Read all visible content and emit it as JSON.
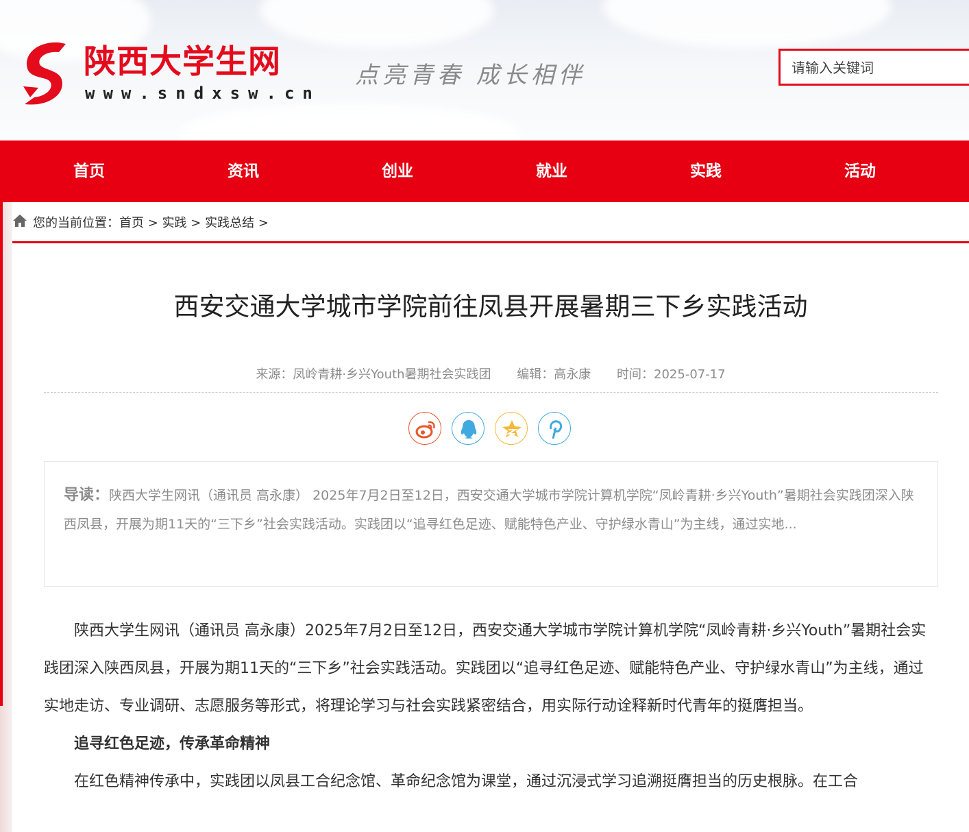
{
  "header": {
    "site_name": "陕西大学生网",
    "site_url": "www.sndxsw.cn",
    "slogan": "点亮青春 成长相伴",
    "search_placeholder": "请输入关键词"
  },
  "nav": {
    "items": [
      "首页",
      "资讯",
      "创业",
      "就业",
      "实践",
      "活动"
    ]
  },
  "breadcrumb": {
    "prefix": "您的当前位置：",
    "items": [
      "首页",
      "实践",
      "实践总结"
    ],
    "separator": ">"
  },
  "article": {
    "title": "西安交通大学城市学院前往凤县开展暑期三下乡实践活动",
    "meta": {
      "source": "来源：凤岭青耕·乡兴Youth暑期社会实践团",
      "editor": "编辑：高永康",
      "time": "时间：2025-07-17"
    },
    "share_icons": [
      "weibo-icon",
      "qq-icon",
      "qzone-icon",
      "pinterest-icon"
    ],
    "lead_label": "导读：",
    "lead_text": "陕西大学生网讯（通讯员 高永康） 2025年7月2日至12日，西安交通大学城市学院计算机学院“凤岭青耕·乡兴Youth”暑期社会实践团深入陕西凤县，开展为期11天的“三下乡”社会实践活动。实践团以“追寻红色足迹、赋能特色产业、守护绿水青山”为主线，通过实地...",
    "paragraphs": [
      "陕西大学生网讯（通讯员 高永康）2025年7月2日至12日，西安交通大学城市学院计算机学院“凤岭青耕·乡兴Youth”暑期社会实践团深入陕西凤县，开展为期11天的“三下乡”社会实践活动。实践团以“追寻红色足迹、赋能特色产业、守护绿水青山”为主线，通过实地走访、专业调研、志愿服务等形式，将理论学习与社会实践紧密结合，用实际行动诠释新时代青年的挺膺担当。",
      "追寻红色足迹，传承革命精神",
      "在红色精神传承中，实践团以凤县工合纪念馆、革命纪念馆为课堂，通过沉浸式学习追溯挺膺担当的历史根脉。在工合"
    ]
  },
  "colors": {
    "brand_red": "#e60012",
    "nav_text": "#ffffff",
    "meta_gray": "#8c8c8c"
  }
}
